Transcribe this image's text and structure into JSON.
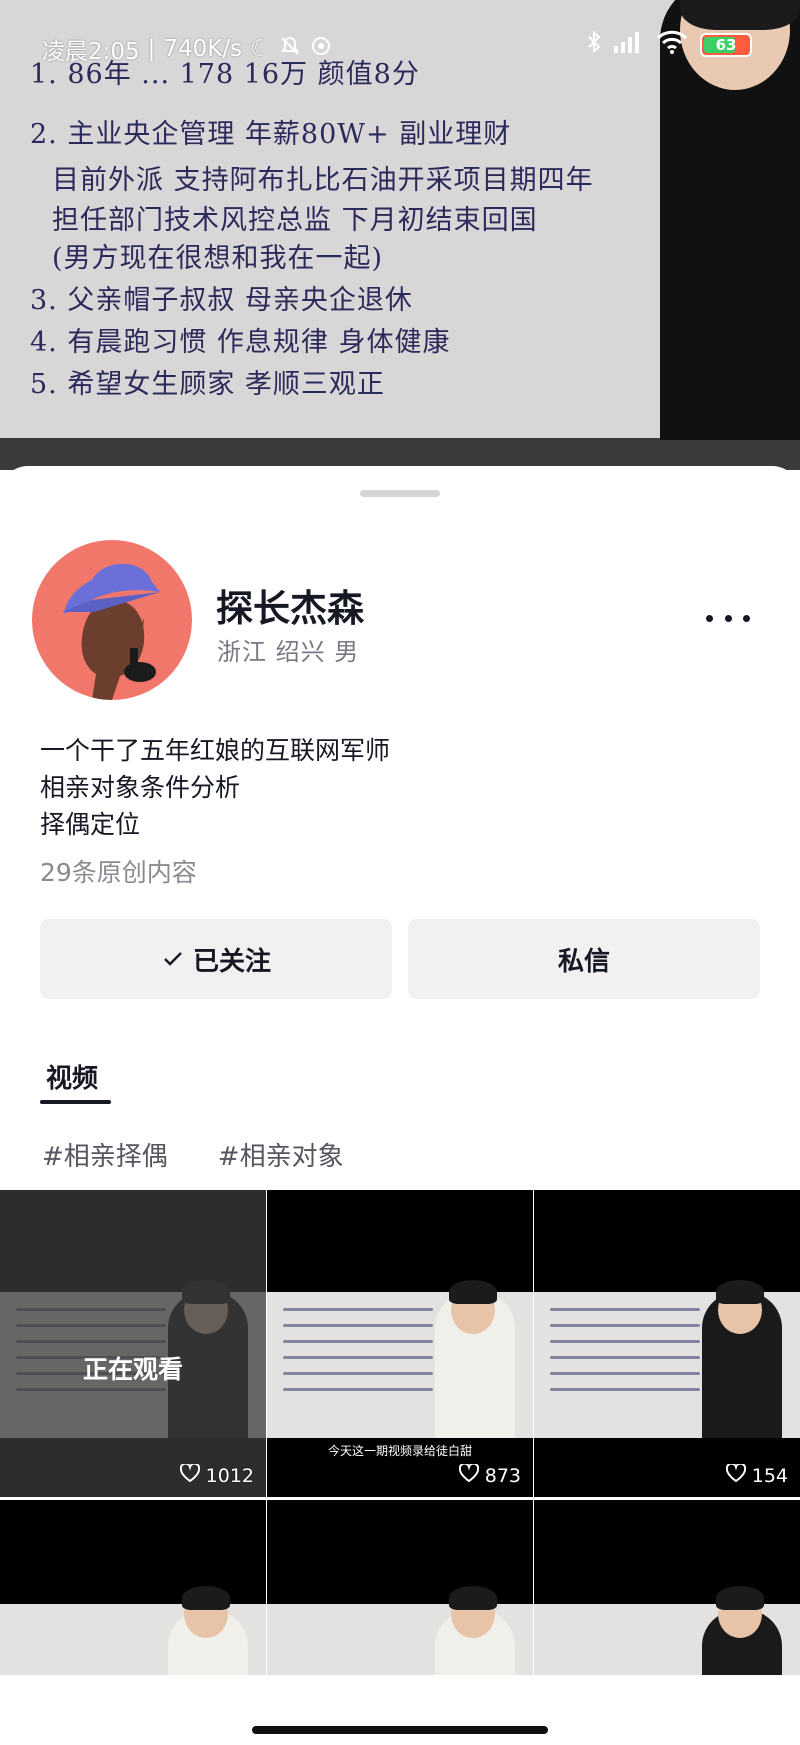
{
  "status_bar": {
    "time": "凌晨2:05",
    "network_speed": "740K/s",
    "battery_level": "63"
  },
  "video": {
    "whiteboard_lines": [
      "1. 86年 ... 178 16万 颜值8分",
      "2. 主业央企管理 年薪80W+ 副业理财",
      "目前外派 支持阿布扎比石油开采项目期四年",
      "担任部门技术风控总监 下月初结束回国",
      "(男方现在很想和我在一起)",
      "3. 父亲帽子叔叔 母亲央企退休",
      "4. 有晨跑习惯 作息规律 身体健康",
      "5. 希望女生顾家 孝顺三观正"
    ]
  },
  "profile": {
    "username": "探长杰森",
    "location": "浙江 绍兴 男",
    "bio": [
      "一个干了五年红娘的互联网军师",
      "相亲对象条件分析",
      "择偶定位"
    ],
    "content_count": "29条原创内容",
    "follow_label": "已关注",
    "message_label": "私信"
  },
  "tabs": {
    "video": "视频"
  },
  "hashtags": [
    "#相亲择偶",
    "#相亲对象"
  ],
  "grid": [
    {
      "likes": "1012",
      "watching": "正在观看",
      "caption": "",
      "person": "dark"
    },
    {
      "likes": "873",
      "watching": "",
      "caption": "今天这一期视频录给徒白甜",
      "person": "light"
    },
    {
      "likes": "154",
      "watching": "",
      "caption": "",
      "person": "dark"
    },
    {
      "likes": "",
      "watching": "",
      "caption": "",
      "person": "light"
    },
    {
      "likes": "",
      "watching": "",
      "caption": "",
      "person": "light"
    },
    {
      "likes": "",
      "watching": "",
      "caption": "",
      "person": "dark"
    }
  ],
  "colors": {
    "avatar_bg": "#f2776b",
    "button_bg": "#f1f1f2",
    "text_primary": "#161823",
    "text_secondary": "#777983"
  }
}
